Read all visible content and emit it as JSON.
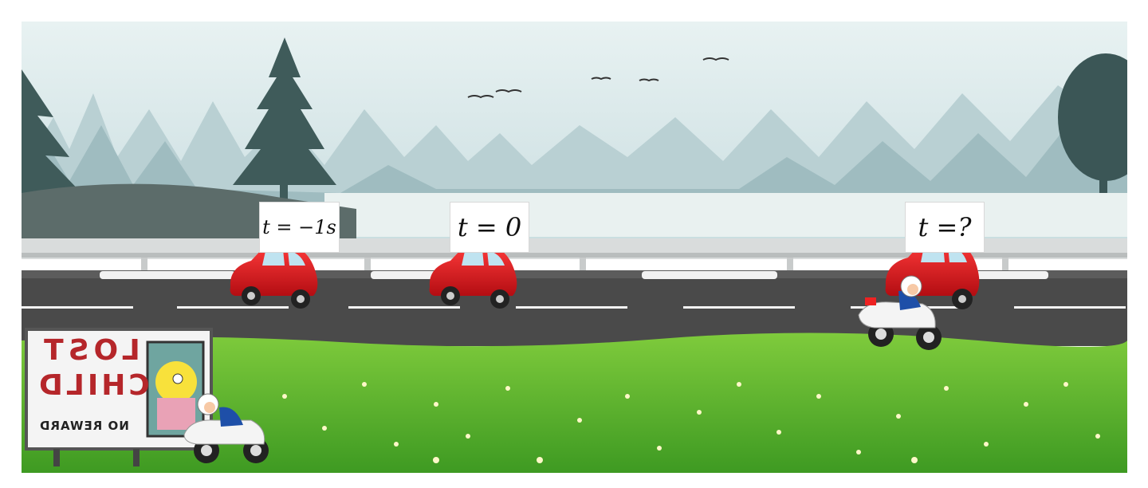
{
  "labels": [
    {
      "text": "t = −1s"
    },
    {
      "text": "t = 0"
    },
    {
      "text": "t =?"
    }
  ],
  "sign": {
    "line1": "LOST",
    "line2": "CHILD",
    "line3": "NO REWARD"
  },
  "colors": {
    "sky": "#dce9ea",
    "road": "#4a4a4a",
    "grass": "#55b32a",
    "car": "#d8141b"
  }
}
